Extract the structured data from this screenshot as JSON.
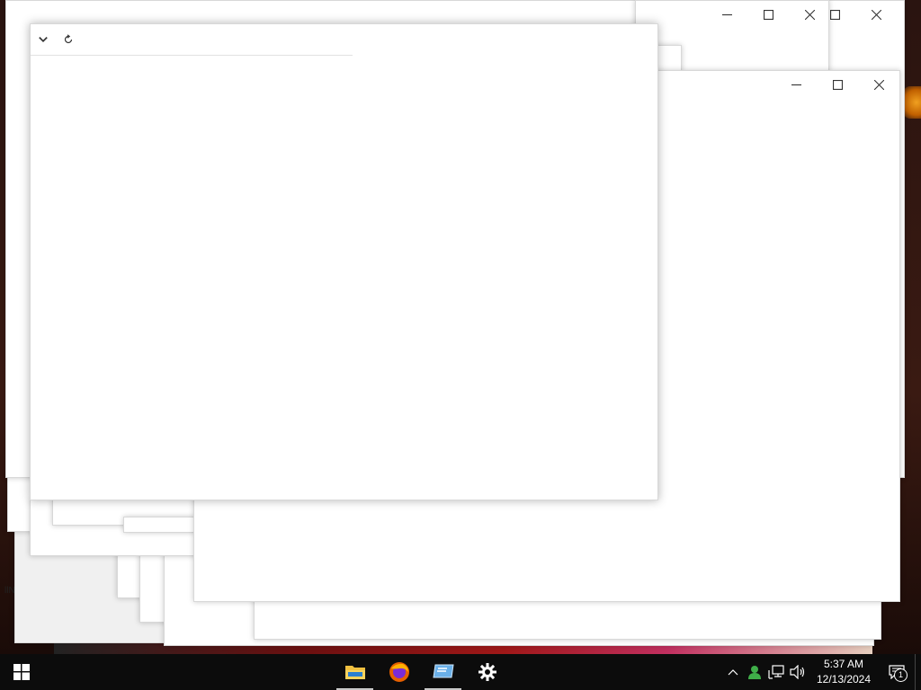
{
  "desktop": {
    "edge_text": "llN"
  },
  "explorer_window": {
    "toolbar": {
      "collapse_icon": "chevron-down-icon",
      "refresh_icon": "refresh-icon"
    }
  },
  "taskbar": {
    "apps": [
      {
        "name": "File Explorer",
        "icon": "folder-icon"
      },
      {
        "name": "Firefox",
        "icon": "firefox-icon"
      },
      {
        "name": "Remote Desktop",
        "icon": "remote-desktop-icon"
      },
      {
        "name": "Settings",
        "icon": "gear-icon"
      }
    ],
    "clock": {
      "time": "5:37 AM",
      "date": "12/13/2024"
    },
    "notification_count": "1"
  },
  "colors": {
    "taskbar_bg": "#0c0c0c",
    "window_bg": "#ffffff",
    "accent_blue": "#0078d7"
  }
}
